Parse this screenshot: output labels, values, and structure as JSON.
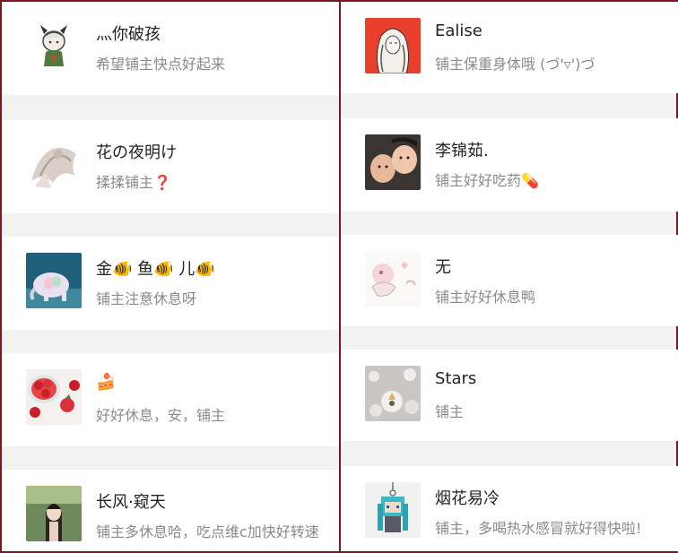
{
  "left": [
    {
      "name": "灬你破孩",
      "message": "希望铺主快点好起来"
    },
    {
      "name": "花の夜明け",
      "message": "揉揉铺主❓"
    },
    {
      "name": "金🐠 鱼🐠 儿🐠",
      "message": "铺主注意休息呀"
    },
    {
      "name": "🍰",
      "message": "好好休息，安，铺主"
    },
    {
      "name": "长风·窥天",
      "message": "铺主多休息哈，吃点维c加快好转速"
    }
  ],
  "right": [
    {
      "name": "Ealise",
      "message": "铺主保重身体哦 (づ'▿')づ"
    },
    {
      "name": "李锦茹.",
      "message": "铺主好好吃药💊"
    },
    {
      "name": "无",
      "message": "铺主好好休息鸭"
    },
    {
      "name": "Stars",
      "message": "铺主"
    },
    {
      "name": "烟花易冷",
      "message": "铺主，多喝热水感冒就好得快啦!"
    }
  ],
  "colors": {
    "border": "#7a1720",
    "separator": "#f2f2f2",
    "name": "#222222",
    "message": "#8a8a8a"
  }
}
